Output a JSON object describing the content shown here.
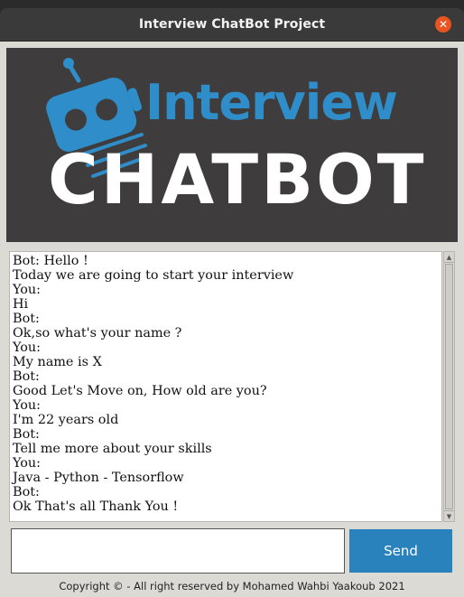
{
  "window": {
    "title": "Interview ChatBot Project",
    "close_glyph": "✕"
  },
  "banner": {
    "logo_icon": "robot-head-icon",
    "logo_word": "Interview",
    "logo_big": "CHATBOT",
    "colors": {
      "accent": "#2f8ec9",
      "background": "#3f3c3d",
      "text": "#ffffff"
    }
  },
  "chat": {
    "lines": [
      "Bot: Hello !",
      "Today we are going to start your interview",
      "You:",
      "Hi",
      "Bot:",
      "Ok,so what's your name ?",
      "You:",
      "My name is X",
      "Bot:",
      "Good Let's Move on, How old are you?",
      "You:",
      "I'm 22 years old",
      "Bot:",
      "Tell me more about your skills",
      "You:",
      "Java - Python - Tensorflow",
      "Bot:",
      "Ok That's all Thank You !"
    ]
  },
  "input": {
    "value": "",
    "placeholder": ""
  },
  "send": {
    "label": "Send",
    "color": "#2a82bd"
  },
  "footer": {
    "text": "Copyright © - All right reserved by Mohamed Wahbi Yaakoub 2021"
  }
}
